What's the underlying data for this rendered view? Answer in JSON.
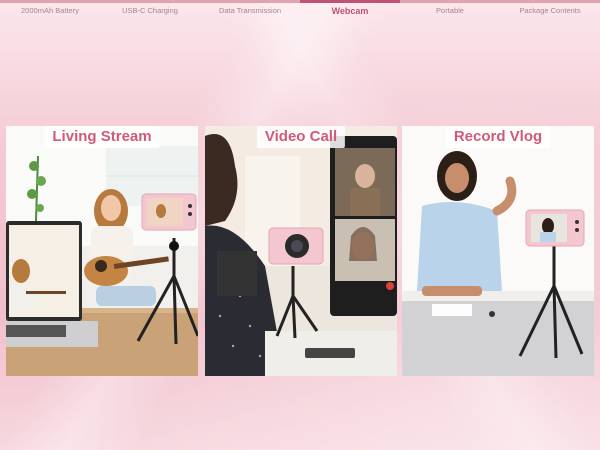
{
  "tabs": [
    {
      "label": "2000mAh Battery"
    },
    {
      "label": "USB-C Charging"
    },
    {
      "label": "Data Transmission"
    },
    {
      "label": "Webcam",
      "active": true
    },
    {
      "label": "Portable"
    },
    {
      "label": "Package Contents"
    }
  ],
  "panels": [
    {
      "title": "Living Stream"
    },
    {
      "title": "Video Call"
    },
    {
      "title": "Record Vlog"
    }
  ],
  "colors": {
    "accent": "#d05a78",
    "camera_pink": "#f3c6d0",
    "background": "#f4c9d3"
  },
  "icons": [
    "camera-icon",
    "tripod-icon",
    "laptop-icon",
    "plant-icon",
    "end-call-icon"
  ]
}
